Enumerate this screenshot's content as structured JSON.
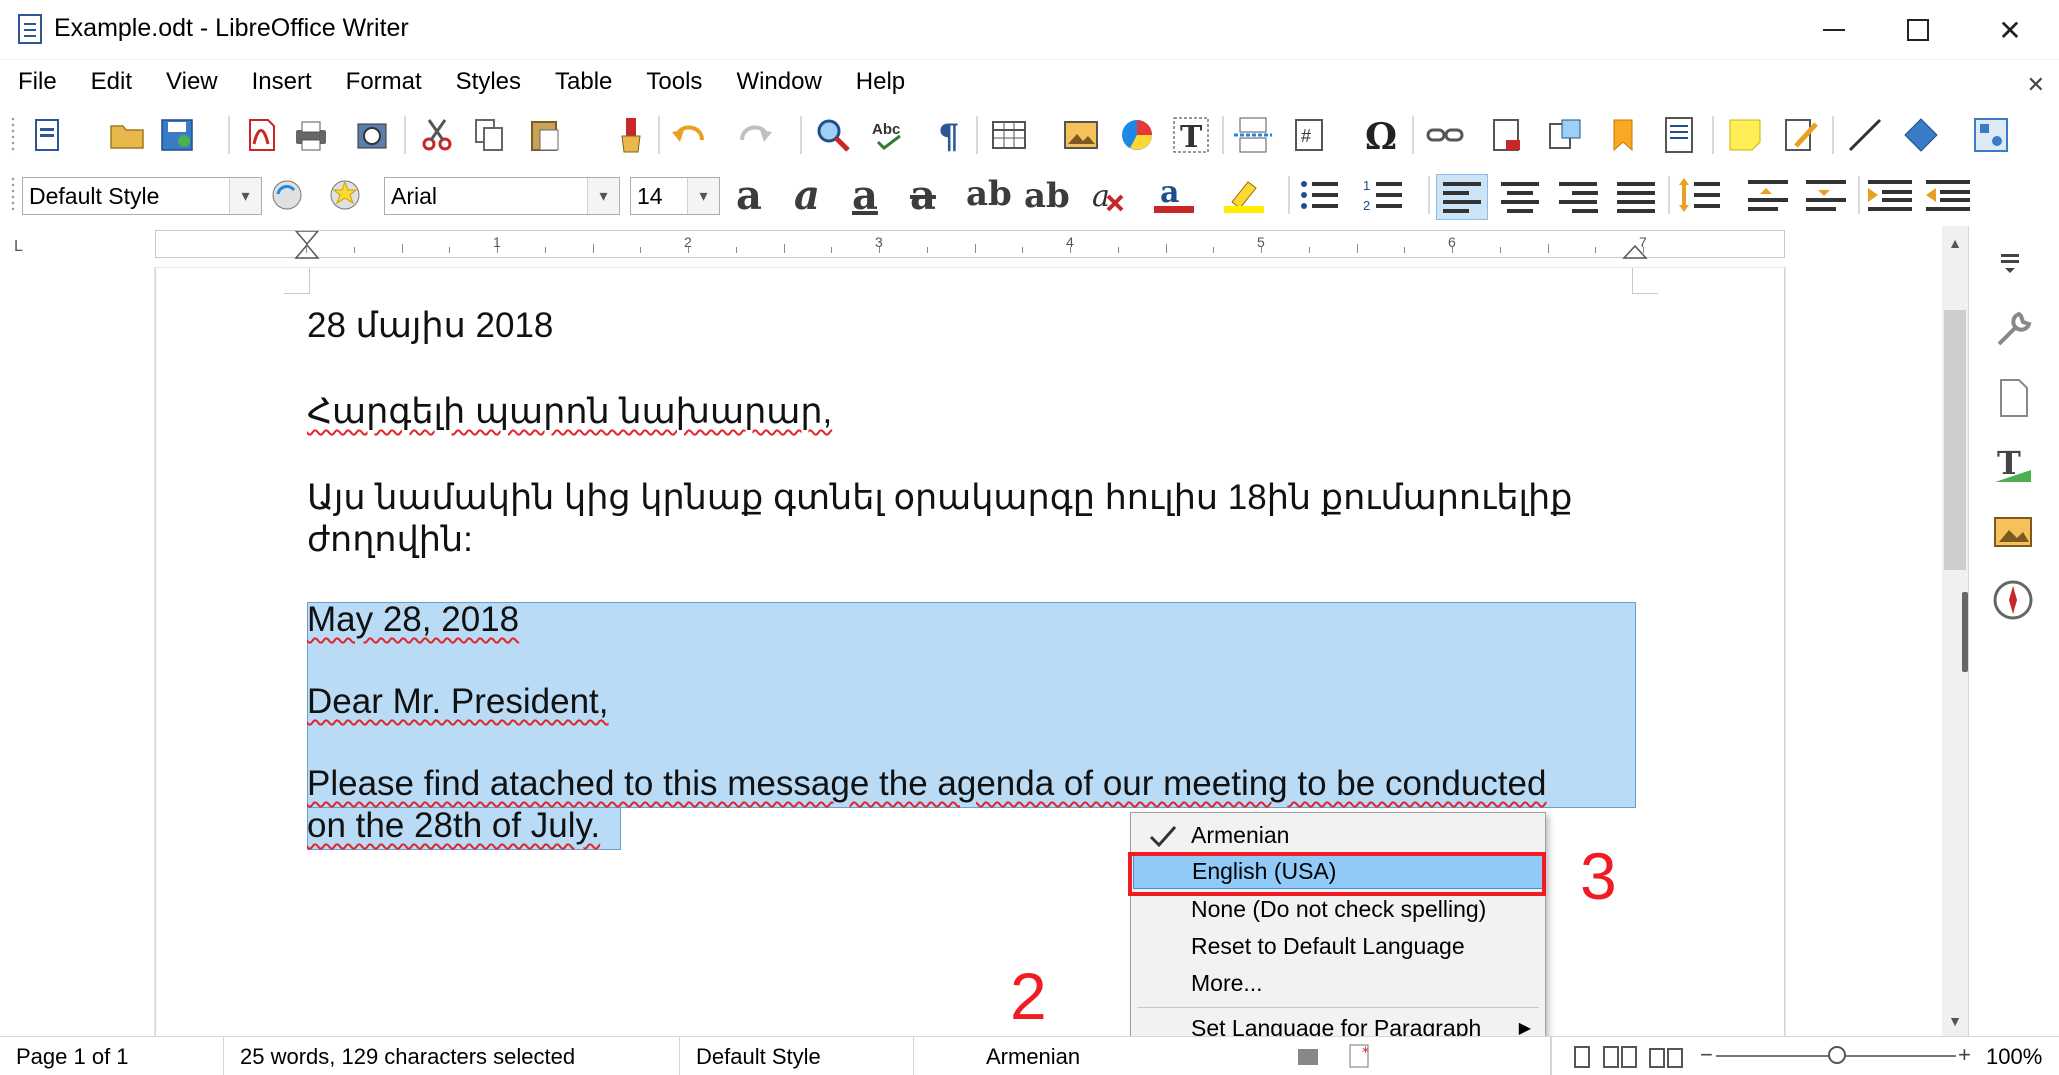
{
  "window": {
    "title": "Example.odt - LibreOffice Writer",
    "minimize_glyph": "—",
    "close_glyph": "✕"
  },
  "menu": [
    "File",
    "Edit",
    "View",
    "Insert",
    "Format",
    "Styles",
    "Table",
    "Tools",
    "Window",
    "Help"
  ],
  "menu_sidebar_close": "✕",
  "formatting": {
    "paragraph_style": "Default Style",
    "font_name": "Arial",
    "font_size": "14"
  },
  "ruler": {
    "numbers": [
      "1",
      "2",
      "3",
      "4",
      "5",
      "6",
      "7"
    ],
    "corner": "L"
  },
  "document": {
    "armenian": {
      "date": "28 մայիս 2018",
      "greeting": "Հարգելի պարոն նախարար,",
      "body_line1": "Այս նամակին կից կրնաք գտնել օրակարգը հուլիս 18ին քումարուելիք",
      "body_line2": "ժողովին:"
    },
    "english": {
      "date": "May 28, 2018",
      "greeting": "Dear Mr. President,",
      "body_line1": "Please find atached to this message the agenda of our meeting to be conducted",
      "body_line2": "on the 28th of July."
    }
  },
  "context_menu": {
    "items": [
      {
        "label": "Armenian",
        "checked": true
      },
      {
        "label": "English (USA)",
        "highlighted": true
      },
      {
        "label": "None (Do not check spelling)"
      },
      {
        "label": "Reset to Default Language"
      },
      {
        "label": "More..."
      },
      {
        "label": "Set Language for Paragraph",
        "submenu": true
      }
    ]
  },
  "annotations": {
    "step2": "2",
    "step3": "3",
    "color": "#ef1c24"
  },
  "statusbar": {
    "page": "Page 1 of 1",
    "words": "25 words, 129 characters selected",
    "page_style": "Default Style",
    "language": "Armenian",
    "zoom": "100%",
    "zoom_percent": 100
  },
  "colors": {
    "selection": "#b9dbf5",
    "menu_highlight": "#91c9f7",
    "spell_error": "#e0262b"
  }
}
